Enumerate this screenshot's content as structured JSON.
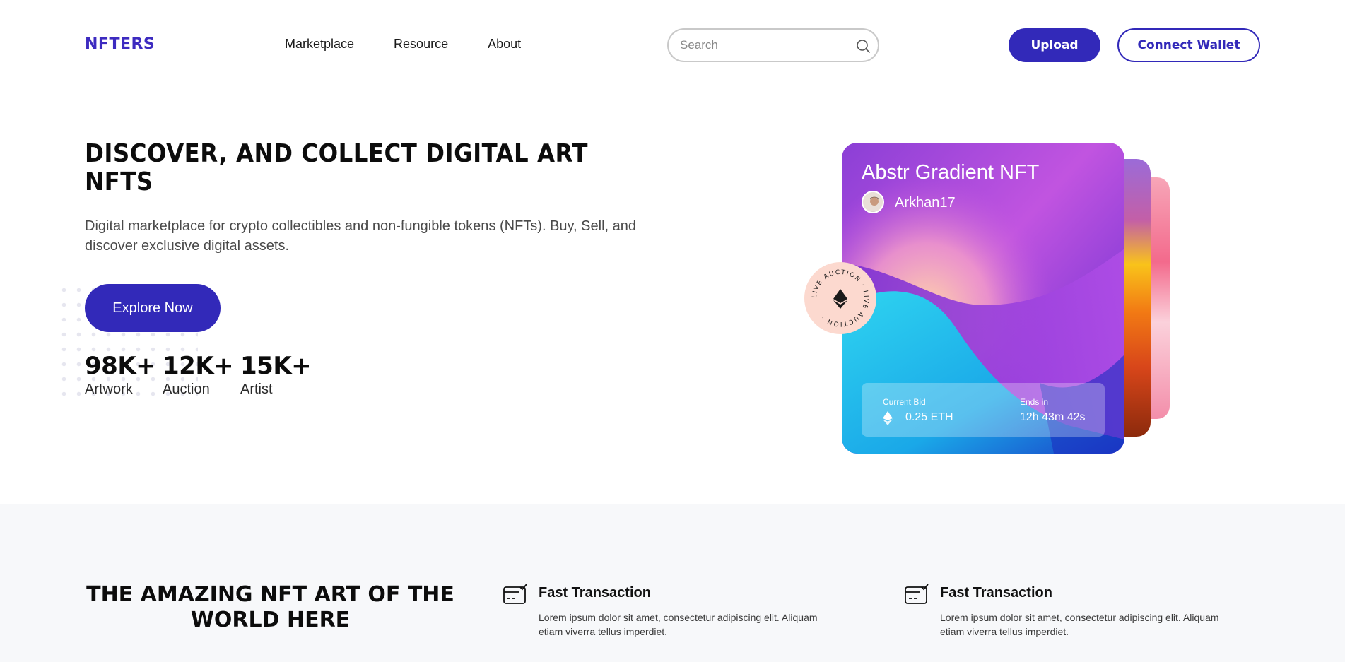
{
  "header": {
    "logo": "NFTERS",
    "nav": [
      "Marketplace",
      "Resource",
      "About"
    ],
    "search_placeholder": "Search",
    "upload_label": "Upload",
    "wallet_label": "Connect Wallet"
  },
  "hero": {
    "title": "DISCOVER, AND COLLECT DIGITAL ART NFTS",
    "subtitle": "Digital marketplace for crypto collectibles and non-fungible tokens (NFTs). Buy, Sell, and discover exclusive digital assets.",
    "cta_label": "Explore Now",
    "stats": [
      {
        "value": "98K+",
        "label": "Artwork"
      },
      {
        "value": "12K+",
        "label": "Auction"
      },
      {
        "value": "15K+",
        "label": "Artist"
      }
    ]
  },
  "card": {
    "title": "Abstr Gradient NFT",
    "creator": "Arkhan17",
    "current_bid_label": "Current Bid",
    "current_bid_value": "0.25 ETH",
    "ends_label": "Ends in",
    "ends_value": "12h 43m 42s",
    "badge_text": "LIVE AUCTION · LIVE AUCTION ·"
  },
  "bottom": {
    "title": "THE AMAZING NFT ART OF THE WORLD HERE",
    "features": [
      {
        "title": "Fast Transaction",
        "desc": "Lorem ipsum dolor sit amet, consectetur adipiscing elit. Aliquam etiam viverra tellus imperdiet."
      },
      {
        "title": "Fast Transaction",
        "desc": "Lorem ipsum dolor sit amet, consectetur adipiscing elit. Aliquam etiam viverra tellus imperdiet."
      }
    ]
  },
  "colors": {
    "brand": "#3229b9",
    "badge_bg": "#fcd9cf",
    "section_bg": "#f7f8fa"
  },
  "icons": {
    "search": "search-icon",
    "ethereum": "ethereum-icon",
    "feature": "card-check-icon"
  }
}
